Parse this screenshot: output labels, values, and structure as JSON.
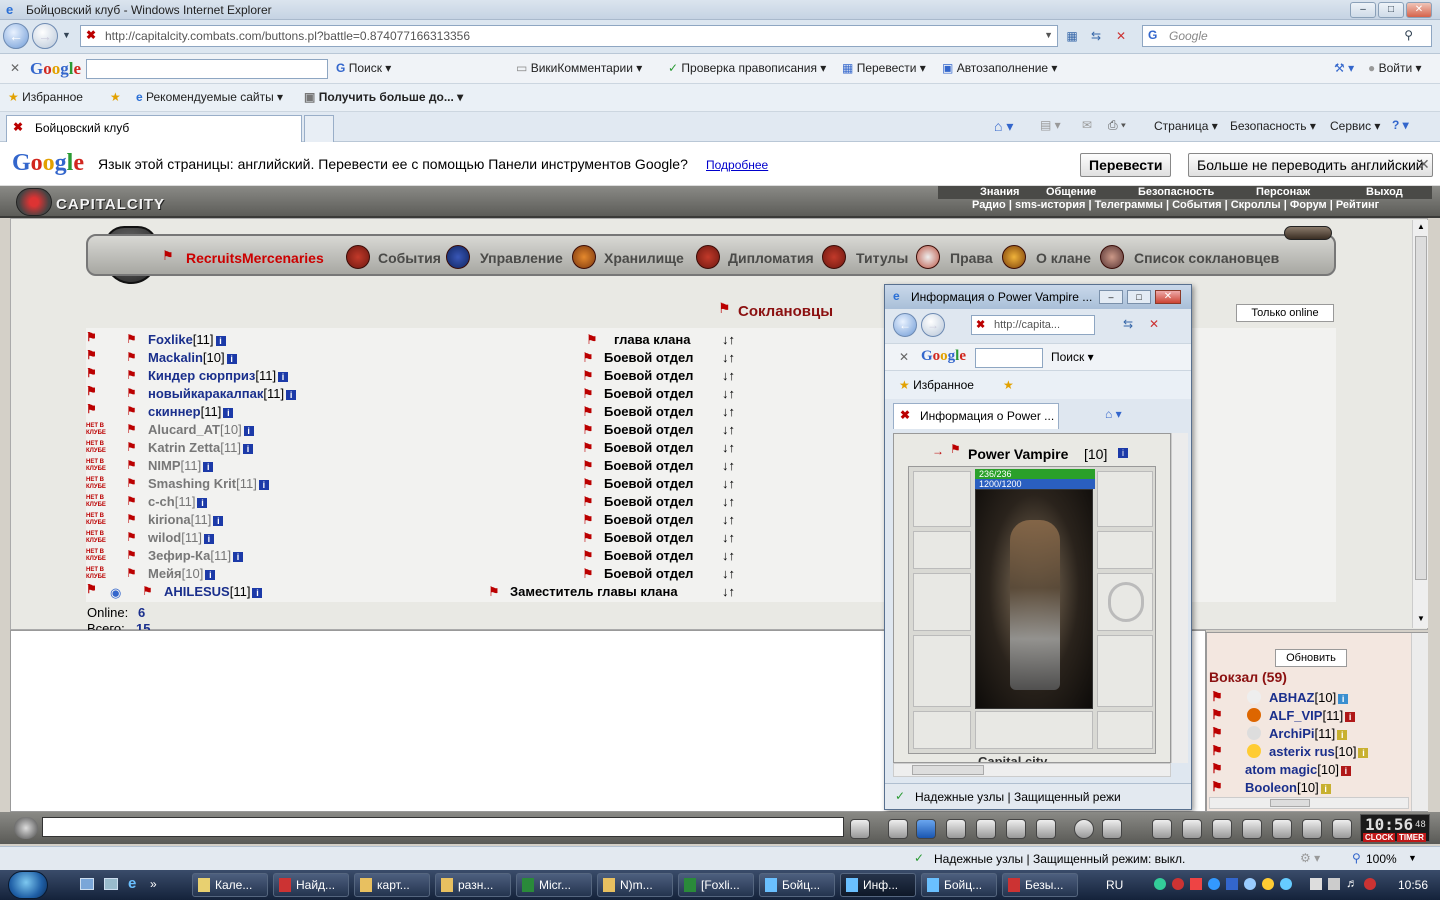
{
  "window": {
    "title": "Бойцовский клуб - Windows Internet Explorer",
    "url": "http://capitalcity.combats.com/buttons.pl?battle=0.874077166313356",
    "search_placeholder": "Google"
  },
  "google_toolbar": {
    "search_label": "Поиск",
    "wiki_label": "ВикиКомментарии",
    "spell_label": "Проверка правописания",
    "translate_label": "Перевести",
    "autofill_label": "Автозаполнение",
    "signin_label": "Войти"
  },
  "favorites_bar": {
    "favorites_label": "Избранное",
    "suggested_label": "Рекомендуемые сайты",
    "more_label": "Получить больше до..."
  },
  "tabs": {
    "active_label": "Бойцовский клуб",
    "page_label": "Страница",
    "safety_label": "Безопасность",
    "service_label": "Сервис"
  },
  "translate_bar": {
    "message": "Язык этой страницы: английский. Перевести ее с помощью Панели инструментов Google?",
    "more_link": "Подробнее",
    "translate_button": "Перевести",
    "never_button": "Больше не переводить английский"
  },
  "game_header": {
    "logo": "CAPITALCITY",
    "top_menu": [
      "Знания",
      "Общение",
      "Безопасность",
      "Персонаж",
      "Выход"
    ],
    "sub_menu": "Радио | sms-история | Телеграммы | События | Скроллы | Форум | Рейтинг"
  },
  "clan_nav": {
    "clan_name": "RecruitsMercenaries",
    "items": [
      "События",
      "Управление",
      "Хранилище",
      "Дипломатия",
      "Титулы",
      "Права",
      "О клане",
      "Список соклановцев"
    ]
  },
  "members": {
    "heading": "Соклановцы",
    "online_only_button": "Только online",
    "list": [
      {
        "name": "Foxlike",
        "level": "[11]",
        "role": "глава клана",
        "online": true,
        "flag": ""
      },
      {
        "name": "Mackalin",
        "level": "[10]",
        "role": "Боевой отдел",
        "online": true,
        "flag": ""
      },
      {
        "name": "Киндер сюрприз",
        "level": "[11]",
        "role": "Боевой отдел",
        "online": true,
        "flag": ""
      },
      {
        "name": "новыйкаракалпак",
        "level": "[11]",
        "role": "Боевой отдел",
        "online": true,
        "flag": ""
      },
      {
        "name": "скиннер",
        "level": "[11]",
        "role": "Боевой отдел",
        "online": true,
        "flag": ""
      },
      {
        "name": "Alucard_AT",
        "level": "[10]",
        "role": "Боевой отдел",
        "online": false,
        "flag": "НЕТ В КЛУБЕ"
      },
      {
        "name": "Katrin Zetta",
        "level": "[11]",
        "role": "Боевой отдел",
        "online": false,
        "flag": "НЕТ В КЛУБЕ"
      },
      {
        "name": "NIMP",
        "level": "[11]",
        "role": "Боевой отдел",
        "online": false,
        "flag": "НЕТ В КЛУБЕ"
      },
      {
        "name": "Smashing Krit",
        "level": "[11]",
        "role": "Боевой отдел",
        "online": false,
        "flag": "НЕТ В КЛУБЕ"
      },
      {
        "name": "c-ch",
        "level": "[11]",
        "role": "Боевой отдел",
        "online": false,
        "flag": "НЕТ В КЛУБЕ"
      },
      {
        "name": "kiriona",
        "level": "[11]",
        "role": "Боевой отдел",
        "online": false,
        "flag": "НЕТ В КЛУБЕ"
      },
      {
        "name": "wilod",
        "level": "[11]",
        "role": "Боевой отдел",
        "online": false,
        "flag": "НЕТ В КЛУБЕ"
      },
      {
        "name": "Зефир-Ка",
        "level": "[11]",
        "role": "Боевой отдел",
        "online": false,
        "flag": "НЕТ В КЛУБЕ"
      },
      {
        "name": "Мейя",
        "level": "[10]",
        "role": "Боевой отдел",
        "online": false,
        "flag": "НЕТ В КЛУБЕ"
      },
      {
        "name": "AHILESUS",
        "level": "[11]",
        "role": "Заместитель главы клана",
        "online": true,
        "flag": ""
      }
    ],
    "online_label": "Online:",
    "online_count": "6",
    "total_label": "Всего:",
    "total_count": "15"
  },
  "popup": {
    "title": "Информация о Power Vampire ...",
    "url": "http://capita...",
    "search_label": "Поиск",
    "favorites_label": "Избранное",
    "tab_label": "Информация о Power ...",
    "character_name": "Power Vampire",
    "character_level": "[10]",
    "hp": "236/236",
    "mana": "1200/1200",
    "hp_fraction": 1.0,
    "mana_fraction": 1.0,
    "footer_text": "Capital city",
    "status": "Надежные узлы | Защищенный режи"
  },
  "online_panel": {
    "refresh_button": "Обновить",
    "location": "Вокзал (59)",
    "players": [
      {
        "name": "ABHAZ",
        "level": "[10]"
      },
      {
        "name": "ALF_VIP",
        "level": "[11]"
      },
      {
        "name": "ArchiPi",
        "level": "[11]"
      },
      {
        "name": "asterix rus",
        "level": "[10]"
      },
      {
        "name": "atom magic",
        "level": "[10]"
      },
      {
        "name": "Booleon",
        "level": "[10]"
      }
    ]
  },
  "clock": {
    "time": "10:56",
    "seconds": "48",
    "clock_label": "CLOCK",
    "timer_label": "TIMER"
  },
  "status_bar": {
    "text": "Надежные узлы | Защищенный режим: выкл.",
    "zoom": "100%"
  },
  "taskbar": {
    "tasks": [
      "Кале...",
      "Найд...",
      "карт...",
      "разн...",
      "Micr...",
      "N)m...",
      "[Foxli...",
      "Бойц...",
      "Инф...",
      "Бойц...",
      "Безы..."
    ],
    "language": "RU",
    "time": "10:56"
  }
}
